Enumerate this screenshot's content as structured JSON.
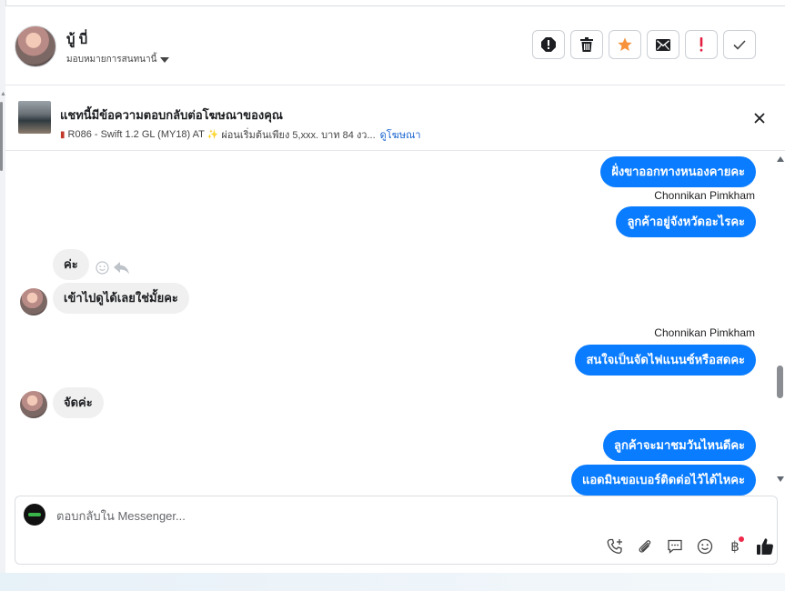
{
  "header": {
    "contact_name": "บู้ บี่",
    "assign_label": "มอบหมายการสนทนานี้"
  },
  "ad_reply": {
    "title": "แชทนี้มีข้อความตอบกลับต่อโฆษณาของคุณ",
    "details": "R086 - Swift 1.2 GL (MY18) AT",
    "promo": "ผ่อนเริ่มต้นเพียง 5,xxx. บาท 84 งว...",
    "link": "ดูโฆษณา"
  },
  "messages": [
    {
      "type": "outgoing",
      "text": "ฝั่งขาออกทางหนองคายคะ"
    },
    {
      "type": "sender",
      "text": "Chonnikan Pimkham"
    },
    {
      "type": "outgoing",
      "text": "ลูกค้าอยู่จังหวัดอะไรคะ"
    },
    {
      "type": "incoming",
      "text": "ค่ะ"
    },
    {
      "type": "incoming",
      "text": "เข้าไปดูได้เลยใช่มั้ยคะ"
    },
    {
      "type": "sender",
      "text": "Chonnikan Pimkham"
    },
    {
      "type": "outgoing",
      "text": "สนใจเป็นจัดไฟแนนซ์หรือสดคะ"
    },
    {
      "type": "incoming",
      "text": "จัดค่ะ"
    },
    {
      "type": "outgoing",
      "text": "ลูกค้าจะมาชมวันไหนดีคะ"
    },
    {
      "type": "outgoing",
      "text": "แอดมินขอเบอร์ติดต่อไว้ได้ไหคะ"
    }
  ],
  "composer": {
    "placeholder": "ตอบกลับใน Messenger...",
    "baht_symbol": "฿"
  },
  "colors": {
    "outgoing_bubble": "#0a7cff",
    "incoming_bubble": "#f0f0f0",
    "star": "#f7923a",
    "alert_red": "#e41e3f",
    "link": "#1763cf"
  },
  "icons": {
    "actions": [
      "report-icon",
      "trash-icon",
      "star-icon",
      "mail-icon",
      "exclamation-icon",
      "check-icon"
    ],
    "composer_tools": [
      "add-call-icon",
      "paperclip-icon",
      "chat-bubble-icon",
      "smiley-icon",
      "baht-icon",
      "thumbs-up-icon"
    ]
  }
}
